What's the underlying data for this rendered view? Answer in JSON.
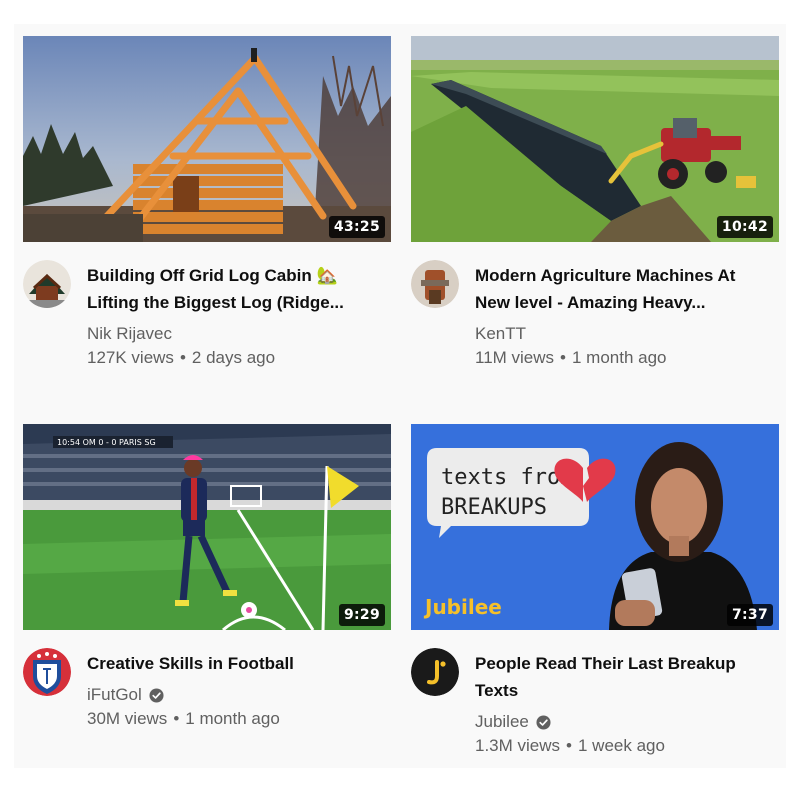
{
  "videos": [
    {
      "title": "Building Off Grid Log Cabin 🏡 Lifting the Biggest Log (Ridge...",
      "duration": "43:25",
      "channel": "Nik Rijavec",
      "verified": false,
      "views": "127K views",
      "age": "2 days ago"
    },
    {
      "title": "Modern Agriculture Machines At New level - Amazing Heavy...",
      "duration": "10:42",
      "channel": "KenTT",
      "verified": false,
      "views": "11M views",
      "age": "1 month ago"
    },
    {
      "title": "Creative Skills in Football",
      "duration": "9:29",
      "channel": "iFutGol",
      "verified": true,
      "views": "30M views",
      "age": "1 month ago"
    },
    {
      "title": "People Read Their Last Breakup Texts",
      "duration": "7:37",
      "channel": "Jubilee",
      "verified": true,
      "views": "1.3M views",
      "age": "1 week ago",
      "thumbnail_text": {
        "line1": "texts from",
        "line2": "BREAKUPS",
        "brand": "Jubilee",
        "scoreboard": "10:54  OM  0 - 0  PARIS SG"
      }
    }
  ],
  "separator": "•",
  "colors": {
    "title": "#0f0f0f",
    "secondary": "#606060",
    "background": "#f9f9f9",
    "jubilee_blue": "#3b73e0",
    "jubilee_yellow": "#f5c02a"
  }
}
